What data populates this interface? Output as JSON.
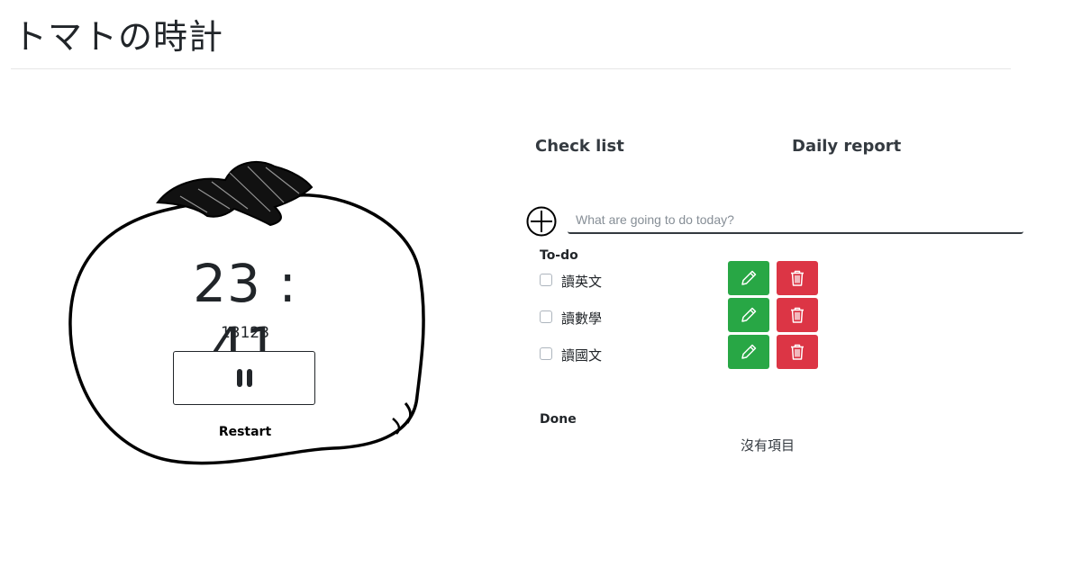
{
  "app": {
    "title": "トマトの時計"
  },
  "timer": {
    "time": "23 : 41",
    "count": "13123",
    "pause_icon": "pause-icon",
    "restart_label": "Restart"
  },
  "nav": {
    "checklist_label": "Check list",
    "report_label": "Daily report"
  },
  "input": {
    "placeholder": "What are going to do today?",
    "value": "",
    "add_icon": "plus-circle-icon"
  },
  "todo": {
    "label": "To-do",
    "items": [
      {
        "text": "讀英文",
        "checked": false
      },
      {
        "text": "讀數學",
        "checked": false
      },
      {
        "text": "讀國文",
        "checked": false
      }
    ],
    "edit_icon": "pencil-icon",
    "delete_icon": "trash-icon"
  },
  "done": {
    "label": "Done",
    "empty_text": "沒有項目"
  },
  "colors": {
    "edit": "#28a745",
    "delete": "#dc3545",
    "text": "#212529"
  }
}
